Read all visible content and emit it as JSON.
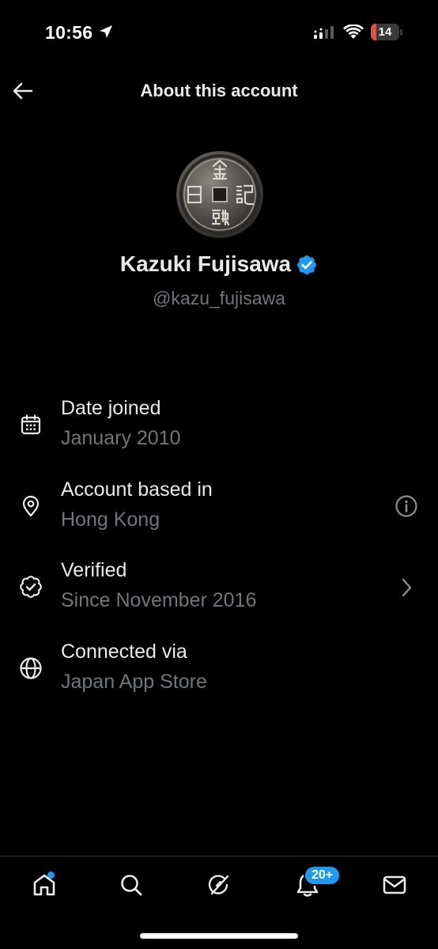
{
  "status_bar": {
    "time": "10:56",
    "battery_level": "14",
    "battery_color": "#eb4e3d"
  },
  "header": {
    "title": "About this account",
    "back_icon": "arrow-left-icon"
  },
  "profile": {
    "display_name": "Kazuki Fujisawa",
    "handle": "@kazu_fujisawa",
    "verified": true,
    "verified_color": "#1d9bf0",
    "avatar": "ancient-coin-avatar"
  },
  "info": [
    {
      "icon": "calendar-icon",
      "label": "Date joined",
      "value": "January 2010"
    },
    {
      "icon": "location-pin-icon",
      "label": "Account based in",
      "value": "Hong Kong",
      "trailing": "info-icon"
    },
    {
      "icon": "verified-check-icon",
      "label": "Verified",
      "value": "Since November 2016",
      "trailing": "chevron-right-icon"
    },
    {
      "icon": "globe-icon",
      "label": "Connected via",
      "value": "Japan App Store"
    }
  ],
  "bottom_nav": {
    "items": [
      "home-icon",
      "search-icon",
      "grok-icon",
      "notifications-icon",
      "messages-icon"
    ],
    "notification_badge": "20+",
    "accent": "#1d9bf0"
  }
}
